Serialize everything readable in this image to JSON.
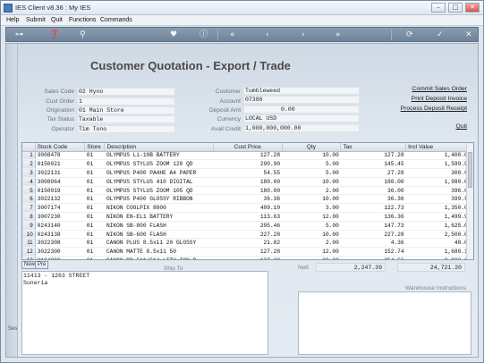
{
  "window": {
    "title": "IES Client v8.36 : My IES"
  },
  "menu": [
    "Help",
    "Submit",
    "Quit",
    "Functions",
    "Commands"
  ],
  "toolbar": {
    "icons": [
      "key-icon",
      "help-icon",
      "search-icon",
      "heart-icon",
      "info-icon",
      "rewind-icon",
      "back-icon",
      "forward-icon",
      "fast-forward-icon",
      "refresh-icon",
      "confirm-icon",
      "close-icon"
    ]
  },
  "page": {
    "title": "Customer Quotation - Export / Trade"
  },
  "header_left": {
    "sales_code_label": "Sales Code",
    "sales_code": "02 Hyno",
    "cust_order_label": "Cust Order",
    "cust_order": "1",
    "origination_label": "Origination",
    "origination": "01 Main Store",
    "tax_status_label": "Tax Status",
    "tax_status": "Taxable",
    "operator_label": "Operator",
    "operator": "Tim Tono"
  },
  "header_mid": {
    "customer_label": "Customer",
    "customer": "Tumbleweed",
    "account_label": "Account",
    "account": "07386",
    "deposit_label": "Deposit Amt",
    "deposit": "0.00",
    "currency_label": "Currency",
    "currency": "LOCAL USD",
    "credit_label": "Avail Credit",
    "credit": "1,000,000,000.00"
  },
  "links": {
    "commit": "Commit Sales Order",
    "print_invoice": "Print Deposit Invoice",
    "process_receipt": "Process Deposit Receipt",
    "quit": "Quit"
  },
  "grid": {
    "columns": [
      "Stock Code",
      "Store",
      "Description",
      "Cust Price",
      "Qty",
      "Tax",
      "Incl Value"
    ],
    "rows": [
      [
        "3008478",
        "01",
        "OLYMPUS Li-10B BATTERY",
        "127.28",
        "10.00",
        "127.28",
        "1,400.08"
      ],
      [
        "0150021",
        "01",
        "OLYMPUS STYLUS ZOOM 120 QD",
        "290.90",
        "5.00",
        "145.45",
        "1,599.95"
      ],
      [
        "3022131",
        "01",
        "OLYMPUS P400 PA4HE A4 PAPER",
        "54.55",
        "5.00",
        "27.28",
        "300.03"
      ],
      [
        "3008064",
        "01",
        "OLYMPUS STYLUS 410 DIGITAL",
        "180.00",
        "10.00",
        "180.00",
        "1,980.00"
      ],
      [
        "0150019",
        "01",
        "OLYMPUS STYLUS ZOOM 105 QD",
        "180.00",
        "2.00",
        "36.00",
        "396.00"
      ],
      [
        "3022132",
        "01",
        "OLYMPUS P400 GLOSSY RIBBON",
        "36.36",
        "10.00",
        "36.36",
        "399.96"
      ],
      [
        "3007174",
        "01",
        "NIKON COOLPIX 8800",
        "409.10",
        "3.00",
        "122.73",
        "1,350.03"
      ],
      [
        "3007230",
        "01",
        "NIKON EN-EL1 BATTERY",
        "113.63",
        "12.00",
        "136.36",
        "1,499.92"
      ],
      [
        "0243140",
        "01",
        "NIKON SB-800 FLASH",
        "295.46",
        "5.00",
        "147.73",
        "1,625.03"
      ],
      [
        "0243138",
        "01",
        "NIKON SB-600 FLASH",
        "227.28",
        "10.00",
        "227.28",
        "2,500.08"
      ],
      [
        "3022308",
        "01",
        "CANON PLUS 8.5x11 20 GLOSSY",
        "21.82",
        "2.00",
        "4.36",
        "48.00"
      ],
      [
        "3022300",
        "01",
        "CANON MATTE 8.5x11 50",
        "127.28",
        "12.00",
        "152.74",
        "1,680.10"
      ],
      [
        "3104290",
        "01",
        "CANON BP-511/514 LITH-ION B",
        "127.28",
        "20.00",
        "254.56",
        "2,800.16"
      ]
    ]
  },
  "grid_buttons": {
    "new": "New",
    "pre": "Pre"
  },
  "ship_to": {
    "label": "Ship To",
    "line1": "11413 - 1263 STREET",
    "line2": "Suneria"
  },
  "totals": {
    "nett_label": "Nett",
    "nett": "2,247.39",
    "incl": "24,721.20"
  },
  "warehouse": {
    "label": "Warehouse Instructions"
  },
  "sidebar": {
    "label": "Ses"
  }
}
